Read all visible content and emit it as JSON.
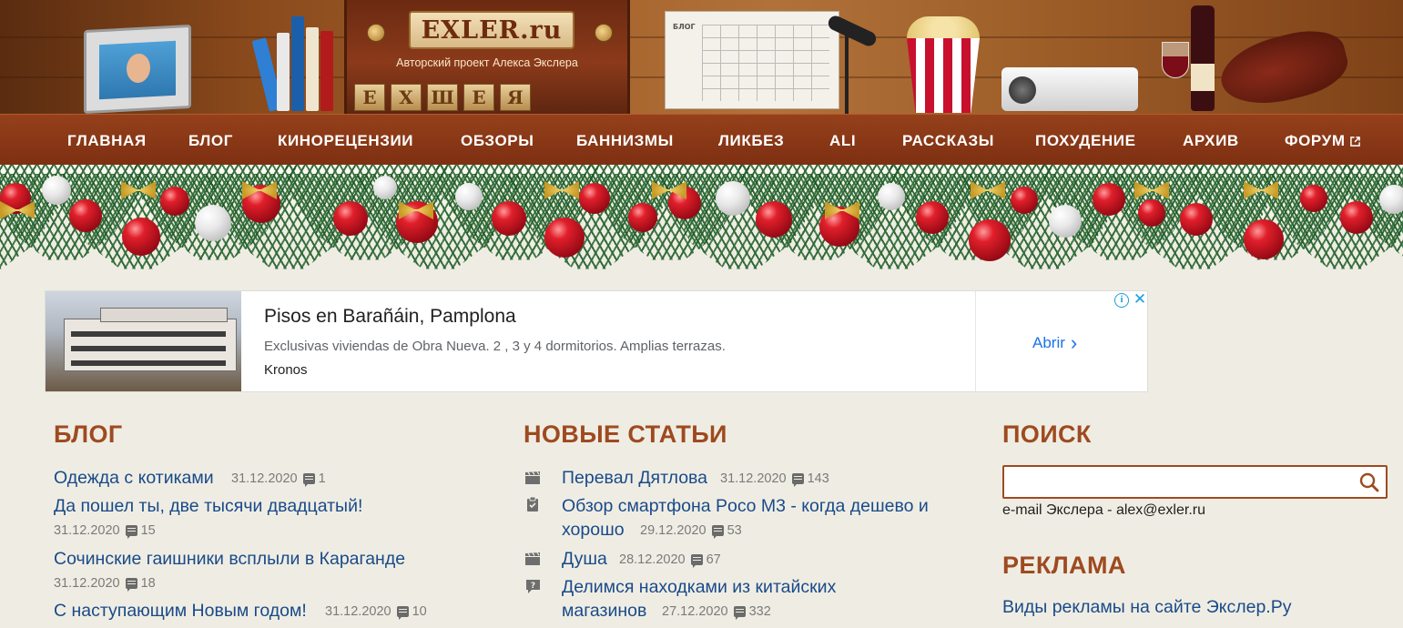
{
  "header": {
    "logo_text": "EXLER.ru",
    "logo_subtitle": "Авторский проект Алекса Экслера",
    "letter_blocks": [
      "Е",
      "Х",
      "Ш",
      "Е",
      "Я"
    ],
    "calendar_label": "БЛОГ"
  },
  "nav": {
    "items": [
      {
        "label": "ГЛАВНАЯ"
      },
      {
        "label": "БЛОГ"
      },
      {
        "label": "КИНОРЕЦЕНЗИИ"
      },
      {
        "label": "ОБЗОРЫ"
      },
      {
        "label": "БАННИЗМЫ"
      },
      {
        "label": "ЛИКБЕЗ"
      },
      {
        "label": "ALI"
      },
      {
        "label": "РАССКАЗЫ"
      },
      {
        "label": "ПОХУДЕНИЕ"
      },
      {
        "label": "АРХИВ"
      },
      {
        "label": "ФОРУМ",
        "external": true
      }
    ]
  },
  "ad": {
    "title": "Pisos en Barañáin, Pamplona",
    "description": "Exclusivas viviendas de Obra Nueva. 2 , 3 y 4 dormitorios. Amplias terrazas.",
    "source": "Kronos",
    "cta": "Abrir",
    "info_icon": "info-icon",
    "close_icon": "close-icon",
    "link_color": "#1a73e8"
  },
  "blog": {
    "title": "БЛОГ",
    "posts": [
      {
        "title": "Одежда с котиками",
        "date": "31.12.2020",
        "comments": "1"
      },
      {
        "title": "Да пошел ты, две тысячи двадцатый!",
        "date": "31.12.2020",
        "comments": "15"
      },
      {
        "title": "Сочинские гаишники всплыли в Караганде",
        "date": "31.12.2020",
        "comments": "18"
      },
      {
        "title": "С наступающим Новым годом!",
        "date": "31.12.2020",
        "comments": "10"
      }
    ]
  },
  "articles": {
    "title": "НОВЫЕ СТАТЬИ",
    "items": [
      {
        "icon": "clapperboard-icon",
        "title_line1": "Перевал Дятлова",
        "title_line2": "",
        "date": "31.12.2020",
        "comments": "143"
      },
      {
        "icon": "clipboard-check-icon",
        "title_line1": "Обзор смартфона Poco M3 - когда дешево и",
        "title_line2": "хорошо",
        "date": "29.12.2020",
        "comments": "53"
      },
      {
        "icon": "clapperboard-icon",
        "title_line1": "Душа",
        "title_line2": "",
        "date": "28.12.2020",
        "comments": "67"
      },
      {
        "icon": "question-bubble-icon",
        "title_line1": "Делимся находками из китайских",
        "title_line2": "магазинов",
        "date": "27.12.2020",
        "comments": "332"
      }
    ]
  },
  "sidebar": {
    "search_title": "ПОИСК",
    "search_value": "",
    "search_icon": "search-icon",
    "email_line": "e-mail Экслера - alex@exler.ru",
    "ads_title": "РЕКЛАМА",
    "ads_link": "Виды рекламы на сайте Экслер.Ру"
  },
  "colors": {
    "nav_bg": "#95401b",
    "section_title": "#9e4a20",
    "link": "#1a4a8a",
    "page_bg": "#efede3"
  }
}
